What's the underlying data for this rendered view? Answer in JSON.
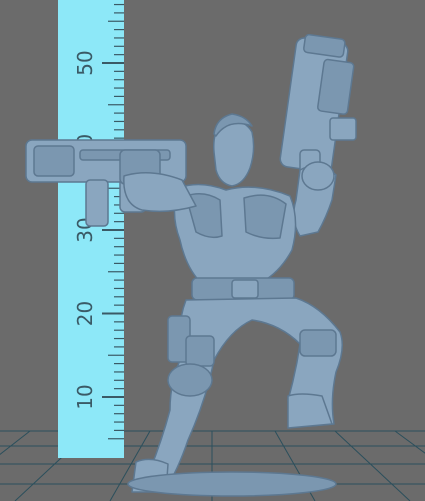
{
  "scene": {
    "background_color": "#6b6b6b",
    "floor_grid_color": "#2b4f5c",
    "model_color": "#8aa6bf",
    "model_shadow_color": "#5d7891"
  },
  "ruler": {
    "color": "#8de8f8",
    "tick_color": "#3a5a66",
    "labels": [
      "10",
      "20",
      "30",
      "40",
      "50"
    ]
  }
}
